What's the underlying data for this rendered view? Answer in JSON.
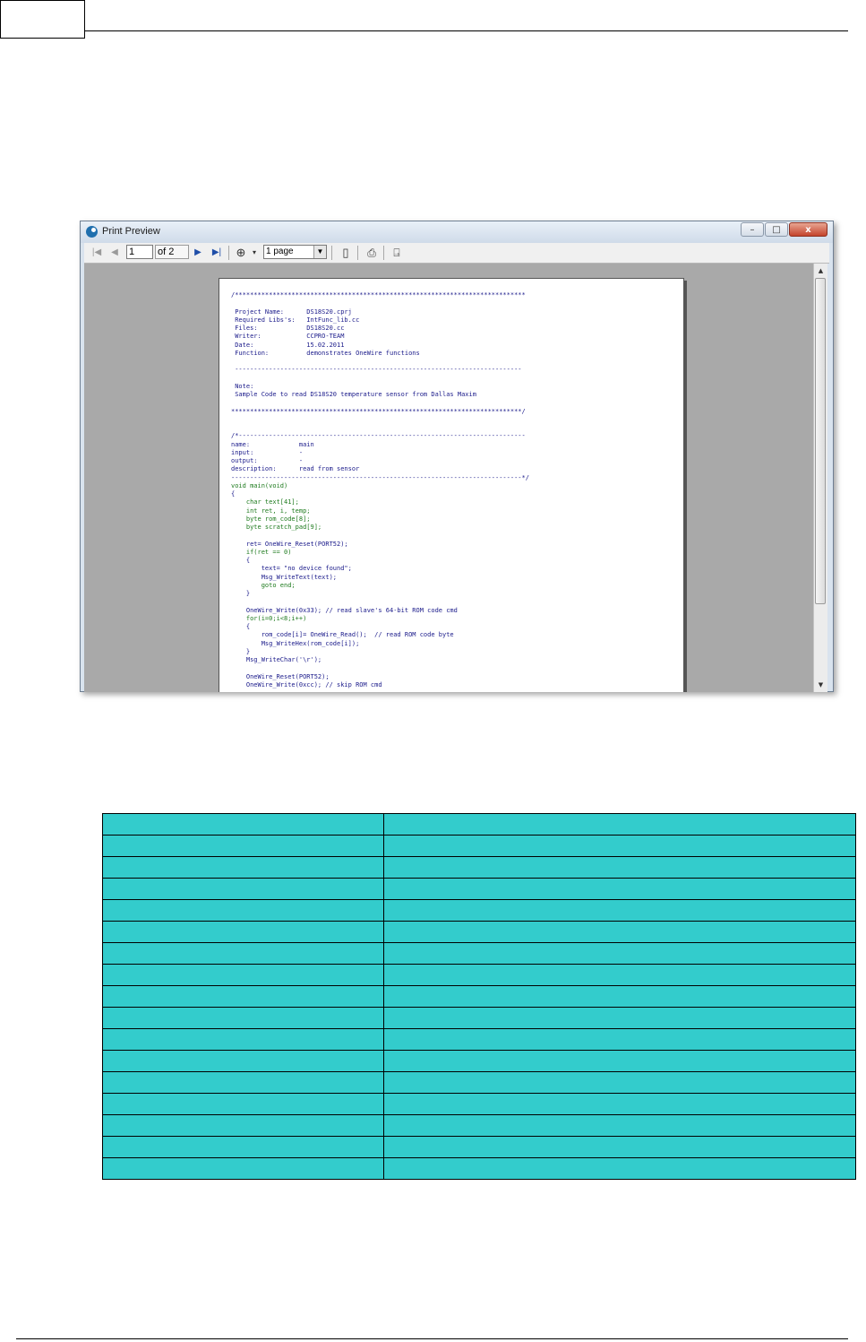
{
  "window": {
    "title": "Print Preview",
    "controls": {
      "minimize": "–",
      "maximize": "□",
      "close": "x"
    }
  },
  "toolbar": {
    "page_number": "1",
    "page_total": "of 2",
    "zoom_value": "1 page"
  },
  "document": {
    "code_lines": [
      "/*****************************************************************************",
      "",
      " Project Name:      DS18S20.cprj",
      " Required Libs's:   IntFunc_lib.cc",
      " Files:             DS18S20.cc",
      " Writer:            CCPRO-TEAM",
      " Date:              15.02.2011",
      " Function:          demonstrates OneWire functions",
      "",
      " ----------------------------------------------------------------------------",
      "",
      " Note:",
      " Sample Code to read DS18S20 temperature sensor from Dallas Maxim",
      "",
      "*****************************************************************************/",
      "",
      "",
      "/*----------------------------------------------------------------------------",
      "name:             main",
      "input:            -",
      "output:           -",
      "description:      read from sensor",
      "-----------------------------------------------------------------------------*/",
      "void main(void)",
      "{",
      "    char text[41];",
      "    int ret, i, temp;",
      "    byte rom_code[8];",
      "    byte scratch_pad[9];",
      "",
      "    ret= OneWire_Reset(PORT52);",
      "    if(ret == 0)",
      "    {",
      "        text= \"no device found\";",
      "        Msg_WriteText(text);",
      "        goto end;",
      "    }",
      "",
      "    OneWire_Write(0x33); // read slave's 64-bit ROM code cmd",
      "    for(i=0;i<8;i++)",
      "    {",
      "        rom_code[i]= OneWire_Read();  // read ROM code byte",
      "        Msg_WriteHex(rom_code[i]);",
      "    }",
      "    Msg_WriteChar('\\r');",
      "",
      "    OneWire_Reset(PORT52);",
      "    OneWire_Write(0xcc); // skip ROM cmd"
    ]
  }
}
